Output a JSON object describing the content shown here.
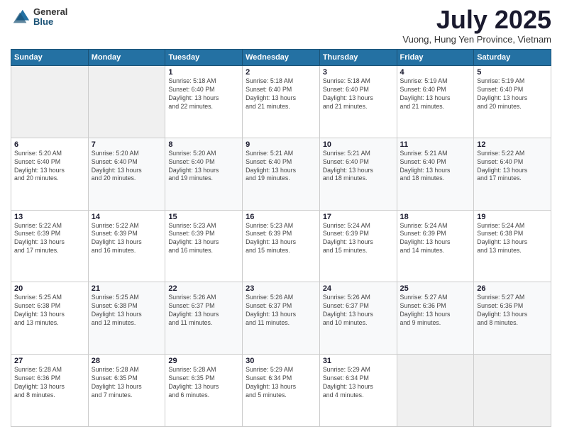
{
  "logo": {
    "general": "General",
    "blue": "Blue"
  },
  "title": "July 2025",
  "subtitle": "Vuong, Hung Yen Province, Vietnam",
  "days": [
    "Sunday",
    "Monday",
    "Tuesday",
    "Wednesday",
    "Thursday",
    "Friday",
    "Saturday"
  ],
  "weeks": [
    [
      {
        "num": "",
        "info": ""
      },
      {
        "num": "",
        "info": ""
      },
      {
        "num": "1",
        "info": "Sunrise: 5:18 AM\nSunset: 6:40 PM\nDaylight: 13 hours\nand 22 minutes."
      },
      {
        "num": "2",
        "info": "Sunrise: 5:18 AM\nSunset: 6:40 PM\nDaylight: 13 hours\nand 21 minutes."
      },
      {
        "num": "3",
        "info": "Sunrise: 5:18 AM\nSunset: 6:40 PM\nDaylight: 13 hours\nand 21 minutes."
      },
      {
        "num": "4",
        "info": "Sunrise: 5:19 AM\nSunset: 6:40 PM\nDaylight: 13 hours\nand 21 minutes."
      },
      {
        "num": "5",
        "info": "Sunrise: 5:19 AM\nSunset: 6:40 PM\nDaylight: 13 hours\nand 20 minutes."
      }
    ],
    [
      {
        "num": "6",
        "info": "Sunrise: 5:20 AM\nSunset: 6:40 PM\nDaylight: 13 hours\nand 20 minutes."
      },
      {
        "num": "7",
        "info": "Sunrise: 5:20 AM\nSunset: 6:40 PM\nDaylight: 13 hours\nand 20 minutes."
      },
      {
        "num": "8",
        "info": "Sunrise: 5:20 AM\nSunset: 6:40 PM\nDaylight: 13 hours\nand 19 minutes."
      },
      {
        "num": "9",
        "info": "Sunrise: 5:21 AM\nSunset: 6:40 PM\nDaylight: 13 hours\nand 19 minutes."
      },
      {
        "num": "10",
        "info": "Sunrise: 5:21 AM\nSunset: 6:40 PM\nDaylight: 13 hours\nand 18 minutes."
      },
      {
        "num": "11",
        "info": "Sunrise: 5:21 AM\nSunset: 6:40 PM\nDaylight: 13 hours\nand 18 minutes."
      },
      {
        "num": "12",
        "info": "Sunrise: 5:22 AM\nSunset: 6:40 PM\nDaylight: 13 hours\nand 17 minutes."
      }
    ],
    [
      {
        "num": "13",
        "info": "Sunrise: 5:22 AM\nSunset: 6:39 PM\nDaylight: 13 hours\nand 17 minutes."
      },
      {
        "num": "14",
        "info": "Sunrise: 5:22 AM\nSunset: 6:39 PM\nDaylight: 13 hours\nand 16 minutes."
      },
      {
        "num": "15",
        "info": "Sunrise: 5:23 AM\nSunset: 6:39 PM\nDaylight: 13 hours\nand 16 minutes."
      },
      {
        "num": "16",
        "info": "Sunrise: 5:23 AM\nSunset: 6:39 PM\nDaylight: 13 hours\nand 15 minutes."
      },
      {
        "num": "17",
        "info": "Sunrise: 5:24 AM\nSunset: 6:39 PM\nDaylight: 13 hours\nand 15 minutes."
      },
      {
        "num": "18",
        "info": "Sunrise: 5:24 AM\nSunset: 6:39 PM\nDaylight: 13 hours\nand 14 minutes."
      },
      {
        "num": "19",
        "info": "Sunrise: 5:24 AM\nSunset: 6:38 PM\nDaylight: 13 hours\nand 13 minutes."
      }
    ],
    [
      {
        "num": "20",
        "info": "Sunrise: 5:25 AM\nSunset: 6:38 PM\nDaylight: 13 hours\nand 13 minutes."
      },
      {
        "num": "21",
        "info": "Sunrise: 5:25 AM\nSunset: 6:38 PM\nDaylight: 13 hours\nand 12 minutes."
      },
      {
        "num": "22",
        "info": "Sunrise: 5:26 AM\nSunset: 6:37 PM\nDaylight: 13 hours\nand 11 minutes."
      },
      {
        "num": "23",
        "info": "Sunrise: 5:26 AM\nSunset: 6:37 PM\nDaylight: 13 hours\nand 11 minutes."
      },
      {
        "num": "24",
        "info": "Sunrise: 5:26 AM\nSunset: 6:37 PM\nDaylight: 13 hours\nand 10 minutes."
      },
      {
        "num": "25",
        "info": "Sunrise: 5:27 AM\nSunset: 6:36 PM\nDaylight: 13 hours\nand 9 minutes."
      },
      {
        "num": "26",
        "info": "Sunrise: 5:27 AM\nSunset: 6:36 PM\nDaylight: 13 hours\nand 8 minutes."
      }
    ],
    [
      {
        "num": "27",
        "info": "Sunrise: 5:28 AM\nSunset: 6:36 PM\nDaylight: 13 hours\nand 8 minutes."
      },
      {
        "num": "28",
        "info": "Sunrise: 5:28 AM\nSunset: 6:35 PM\nDaylight: 13 hours\nand 7 minutes."
      },
      {
        "num": "29",
        "info": "Sunrise: 5:28 AM\nSunset: 6:35 PM\nDaylight: 13 hours\nand 6 minutes."
      },
      {
        "num": "30",
        "info": "Sunrise: 5:29 AM\nSunset: 6:34 PM\nDaylight: 13 hours\nand 5 minutes."
      },
      {
        "num": "31",
        "info": "Sunrise: 5:29 AM\nSunset: 6:34 PM\nDaylight: 13 hours\nand 4 minutes."
      },
      {
        "num": "",
        "info": ""
      },
      {
        "num": "",
        "info": ""
      }
    ]
  ]
}
